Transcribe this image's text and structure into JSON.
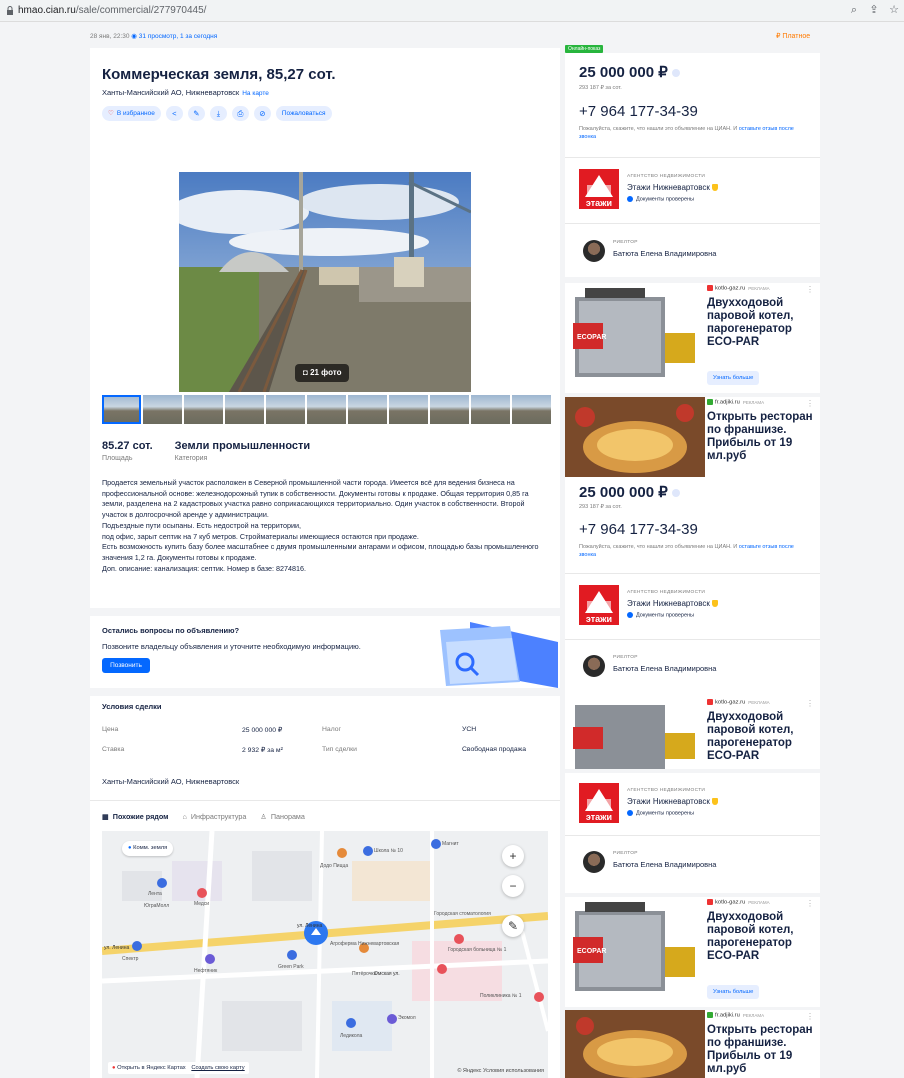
{
  "browser": {
    "url_host": "hmao.cian.ru",
    "url_path": "/sale/commercial/277970445/"
  },
  "meta": {
    "date": "28 янв, 22:30",
    "views": "31 просмотр, 1 за сегодня",
    "paid_label": "Платное"
  },
  "listing": {
    "title": "Коммерческая земля, 85,27 сот.",
    "address": "Ханты-Мансийский АО, Нижневартовск",
    "map_link": "На карте",
    "favorite_label": "В избранное",
    "complain_label": "Пожаловаться",
    "photo_count": "21 фото",
    "facts": [
      {
        "value": "85.27 сот.",
        "label": "Площадь"
      },
      {
        "value": "Земли промышленности",
        "label": "Категория"
      }
    ],
    "description": [
      "Продается земельный участок расположен в Северной промышленной части города. Имеется всё для ведения бизнеса на профессиональной основе: железнодорожный тупик в собственности. Документы готовы к продаже. Общая территория 0,85 га земли, разделена на 2 кадастровых участка равно соприкасающихся территориально. Один участок в собственности. Второй участок в долгосрочной аренде у администрации.",
      "Подъездные пути осыпаны. Есть недострой на территории,",
      "под офис, зарыт септик на 7 куб метров. Стройматериалы имеющиеся остаются при продаже.",
      "Есть возможность купить базу более масштабнее с двумя промышленными ангарами и офисом, площадью базы промышленного значения 1,2 га. Документы готовы к продаже.",
      " Доп. описание: канализация: септик. Номер в базе: 8274816."
    ]
  },
  "questions": {
    "title": "Остались вопросы по объявлению?",
    "text": "Позвоните владельцу объявления и уточните необходимую информацию.",
    "button": "Позвонить"
  },
  "deal": {
    "title": "Условия сделки",
    "rows": [
      {
        "k1": "Цена",
        "v1": "25 000 000 ₽",
        "k2": "Налог",
        "v2": "УСН"
      },
      {
        "k1": "Ставка",
        "v1": "2 932 ₽ за м²",
        "k2": "Тип сделки",
        "v2": "Свободная продажа"
      }
    ],
    "region": "Ханты-Мансийский АО, Нижневартовск"
  },
  "map": {
    "tabs": [
      "Похожие рядом",
      "Инфраструктура",
      "Панорама"
    ],
    "chip": "Комм. земля",
    "open_label": "Открыть в Яндекс Картах",
    "create_label": "Создать свою карту",
    "terms": "© Яндекс Условия использования",
    "labels": [
      "ул. Ленина",
      "ул. Ленина",
      "Омская ул.",
      "Лента",
      "ЮграМолл",
      "Медси",
      "Спектр",
      "Нефтяник",
      "Green Park",
      "Агроферма Нижневартовская",
      "Городская больница № 1",
      "Городская стоматология",
      "Школа № 10",
      "Магнит",
      "Додо Пицца",
      "Поликлиника № 1",
      "Экомол",
      "Пятёрочка",
      "Ледикола"
    ]
  },
  "sidebar": {
    "online_badge": "Онлайн-показ",
    "price": "25 000 000 ₽",
    "price_per": "293 187 ₽ за сот.",
    "phone": "+7 964 177-34-39",
    "note": "Пожалуйста, скажите, что нашли это объявление на ЦИАН. И",
    "note_link": "оставьте отзыв после звонка",
    "agency_sub": "АГЕНТСТВО НЕДВИЖИМОСТИ",
    "agency_name": "Этажи Нижневартовск",
    "agency_verified": "Документы проверены",
    "agency_logo_text": "этажи",
    "realtor_sub": "РИЕЛТОР",
    "realtor_name": "Батюта Елена Владимировна"
  },
  "ads": {
    "boiler": {
      "source": "kotlo-gaz.ru",
      "tag": "РЕКЛАМА",
      "headline": "Двухходовой паровой котел, парогенератор ECO-PAR",
      "cta": "Узнать больше",
      "brand": "ECOPAR"
    },
    "restaurant": {
      "source": "fr.adjiki.ru",
      "tag": "РЕКЛАМА",
      "headline": "Открыть ресторан по франшизе. Прибыль от 19 мл.руб"
    }
  },
  "colors": {
    "accent": "#0468ff",
    "paid": "#ff7a00",
    "online": "#28b53d",
    "agency_red": "#e11b22"
  }
}
